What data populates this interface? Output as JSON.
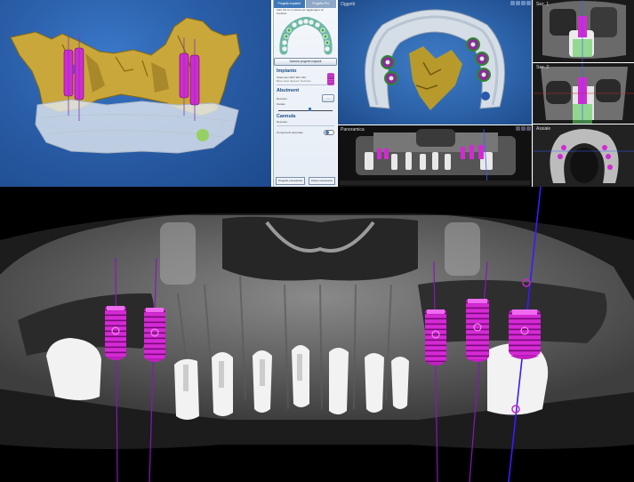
{
  "planning_panel": {
    "tabs": [
      "Progetto implanti",
      "Progetto Pro"
    ],
    "subtitle": "Fare clic su un dente per aggiungere un impianto",
    "numbering_button": "Numera progetto impianti",
    "implant_section": "Impianto",
    "implant_name": "Straumann BLT Ø4.1 RC",
    "implant_desc": "Bone level tapered, SLActive",
    "abutment_section": "Abutment",
    "abutment_value": "Nessuno",
    "sleeve_label": "Canale",
    "sleeve_section": "Cannula",
    "sleeve_value": "Nessuna",
    "components_label": "Componenti associate",
    "footer_prev": "Progetto precedente",
    "footer_next": "Passo successivo"
  },
  "viewports": {
    "arch_title": "Oggetti",
    "ct_small_label": "Panoramica",
    "cross_label_1": "Sez. 1",
    "cross_label_2": "Sez. 2",
    "cross_label_3": "Assiale"
  },
  "colors": {
    "implant": "#d02ad0",
    "bone": "#c8a83a",
    "viewport_blue": "#2a5ea8",
    "guide_line": "#8a18c8",
    "axis_line": "#3a1aff"
  },
  "implants_main": [
    {
      "label": "implant-1"
    },
    {
      "label": "implant-2"
    },
    {
      "label": "implant-3"
    },
    {
      "label": "implant-4"
    },
    {
      "label": "implant-5"
    }
  ]
}
